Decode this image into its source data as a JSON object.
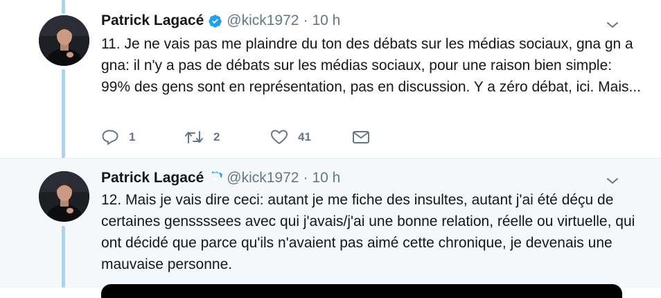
{
  "tweets": [
    {
      "author_name": "Patrick Lagacé",
      "handle": "@kick1972",
      "separator": "·",
      "time": "10 h",
      "text": "11. Je ne vais pas me plaindre du ton des débats sur les médias sociaux, gna gn a gna: il n'y a pas de débats sur les médias sociaux, pour une raison bien simple: 99% des gens sont en représentation, pas en discussion. Y a zéro débat, ici. Mais...",
      "replies": "1",
      "retweets": "2",
      "likes": "41"
    },
    {
      "author_name": "Patrick Lagacé",
      "handle": "@kick1972",
      "separator": "·",
      "time": "10 h",
      "text": "12. Mais je vais dire ceci: autant je me fiche des insultes, autant j'ai été déçu de certaines genssssees avec qui j'avais/j'ai une bonne relation, réelle ou virtuelle, qui ont décidé que parce qu'ils n'avaient pas aimé cette chronique, je devenais une mauvaise personne."
    }
  ],
  "colors": {
    "thread_line": "#a6d4f2",
    "verified": "#1da1f2",
    "muted": "#657786",
    "highlight_bg": "#f5f8fa"
  },
  "icons": [
    "verified-badge-icon",
    "chevron-down-icon",
    "reply-icon",
    "retweet-icon",
    "like-icon",
    "direct-message-icon"
  ]
}
